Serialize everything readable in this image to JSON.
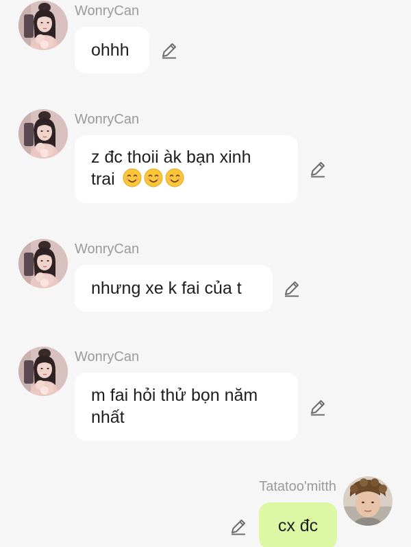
{
  "messages": [
    {
      "sender": "WonryCan",
      "text": "ohhh"
    },
    {
      "sender": "WonryCan",
      "text_line1": "z đc thoii àk bạn xinh",
      "text_line2": "trai",
      "emoji": "smiling-face-with-smiling-eyes",
      "emoji_count": 3
    },
    {
      "sender": "WonryCan",
      "text": "nhưng xe k fai của t"
    },
    {
      "sender": "WonryCan",
      "text_line1": "m fai hỏi thử bọn năm",
      "text_line2": "nhất"
    },
    {
      "sender": "Tatatoo'mitth",
      "text": "cx đc"
    }
  ],
  "colors": {
    "background": "#f6f6f6",
    "incoming_bubble": "#ffffff",
    "outgoing_bubble": "#dcf8a4",
    "sender_name": "#9a9a9a",
    "text": "#1e1e1e"
  },
  "icons": {
    "edit": "pencil-edit-icon"
  }
}
